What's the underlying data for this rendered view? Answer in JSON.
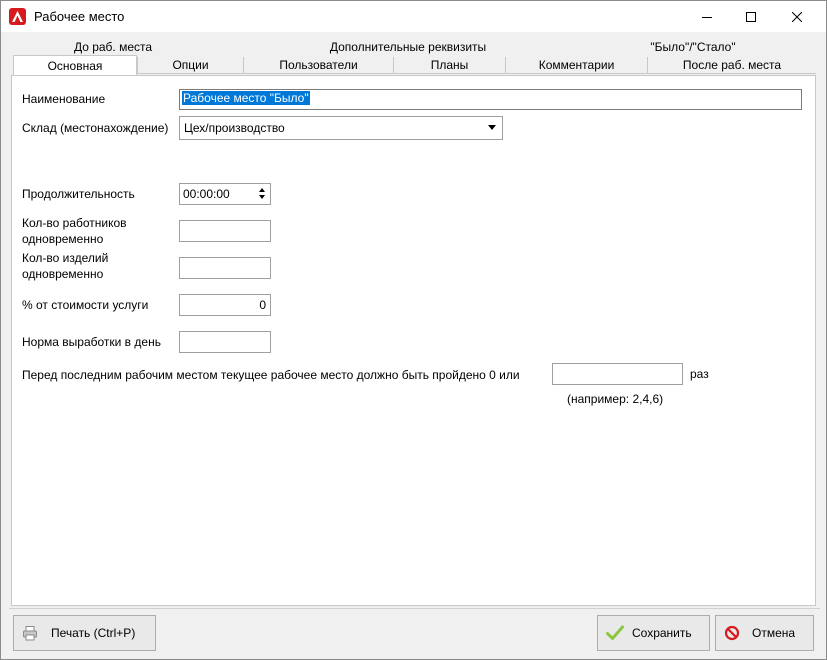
{
  "window": {
    "title": "Рабочее место",
    "icon": "app-logo-icon",
    "accent": "#d71920"
  },
  "tabs": {
    "back_row": [
      "До раб. места",
      "Дополнительные реквизиты",
      "\"Было\"/\"Стало\""
    ],
    "front_row": [
      "Основная",
      "Опции",
      "Пользователи",
      "Планы",
      "Комментарии",
      "После раб. места"
    ],
    "active": "Основная"
  },
  "form": {
    "name_label": "Наименование",
    "name_value": "Рабочее место \"Было\"",
    "warehouse_label": "Склад (местонахождение)",
    "warehouse_value": "Цех/производство",
    "duration_label": "Продолжительность",
    "duration_value": "00:00:00",
    "workers_label_1": "Кол-во работников",
    "workers_label_2": "одновременно",
    "workers_value": "",
    "items_label_1": "Кол-во изделий",
    "items_label_2": "одновременно",
    "items_value": "",
    "percent_label": "% от стоимости услуги",
    "percent_value": "0",
    "norm_label": "Норма выработки в день",
    "norm_value": "",
    "pass_label": "Перед последним рабочим местом текущее рабочее место должно быть пройдено 0 или",
    "pass_value": "",
    "pass_suffix": "раз",
    "pass_hint": "(например: 2,4,6)"
  },
  "buttons": {
    "print": "Печать (Ctrl+P)",
    "save": "Сохранить",
    "cancel": "Отмена"
  }
}
